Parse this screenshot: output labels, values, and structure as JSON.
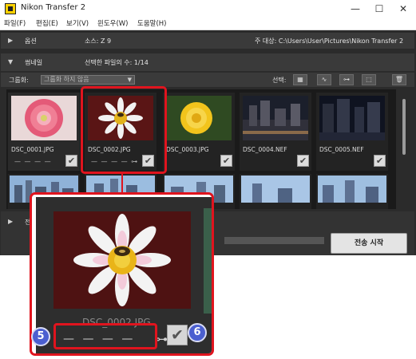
{
  "window": {
    "title": "Nikon Transfer 2",
    "controls": {
      "minimize": "—",
      "maximize": "☐",
      "close": "✕"
    }
  },
  "menubar": {
    "items": [
      "파일(F)",
      "편집(E)",
      "보기(V)",
      "윈도우(W)",
      "도움말(H)"
    ]
  },
  "options_row": {
    "label": "옵션",
    "source": "소스: Z 9",
    "destination": "주 대상: C:\\Users\\User\\Pictures\\Nikon Transfer 2"
  },
  "thumbnails_row": {
    "label": "썸네일",
    "selected_count": "선택한 파일의 수: 1/14"
  },
  "toolbar": {
    "group_label": "그룹화:",
    "group_value": "그룹화 하지 않음",
    "select_label": "선택:"
  },
  "thumbnails": [
    {
      "name": "DSC_0001.JPG",
      "dashes": "— — — —",
      "checked": true
    },
    {
      "name": "DSC_0002.JPG",
      "dashes": "— — — — ⊶",
      "checked": true
    },
    {
      "name": "DSC_0003.JPG",
      "dashes": "",
      "checked": true
    },
    {
      "name": "DSC_0004.NEF",
      "dashes": "",
      "checked": true
    },
    {
      "name": "DSC_0005.NEF",
      "dashes": "",
      "checked": true
    }
  ],
  "bottom": {
    "partial_label": "전",
    "start_button": "전송 시작"
  },
  "zoom": {
    "filename": "DSC_0002.JPG",
    "dashes": "— — — —",
    "key_icon": "⊶",
    "callouts": [
      "5",
      "6"
    ]
  },
  "colors": {
    "highlight": "#e0141e",
    "callout": "#4b5fd0"
  }
}
